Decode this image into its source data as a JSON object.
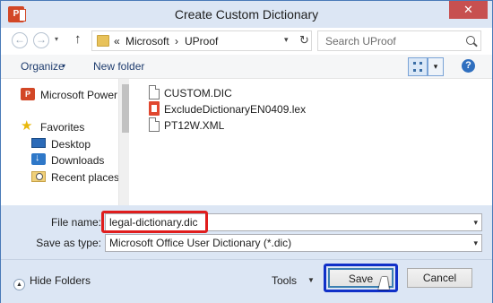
{
  "window": {
    "title": "Create Custom Dictionary",
    "app_icon_letter": "P",
    "close_label": "✕"
  },
  "address": {
    "back_icon": "←",
    "forward_icon": "→",
    "history_icon": "▾",
    "up_icon": "↑",
    "overflow": "«",
    "crumb_1": "Microsoft",
    "sep": "›",
    "crumb_2": "UProof",
    "dropdown_icon": "▾",
    "refresh_icon": "↻"
  },
  "search": {
    "placeholder": "Search UProof"
  },
  "toolbar": {
    "organize_label": "Organize",
    "organize_caret": "▾",
    "new_folder_label": "New folder",
    "view_dropdown": "▾",
    "help_label": "?"
  },
  "nav": {
    "items": [
      {
        "label": "Microsoft PowerPoint",
        "icon": "powerpoint-icon",
        "icon_text": "P"
      },
      {
        "label": "Favorites",
        "icon": "star-icon",
        "icon_text": "★"
      },
      {
        "label": "Desktop",
        "icon": "desktop-icon"
      },
      {
        "label": "Downloads",
        "icon": "downloads-icon"
      },
      {
        "label": "Recent places",
        "icon": "recent-places-icon"
      }
    ]
  },
  "files": [
    {
      "name": "CUSTOM.DIC",
      "icon": "document-icon"
    },
    {
      "name": "ExcludeDictionaryEN0409.lex",
      "icon": "office-document-icon"
    },
    {
      "name": "PT12W.XML",
      "icon": "document-icon"
    }
  ],
  "form": {
    "file_name_label": "File name:",
    "file_name_value": "legal-dictionary.dic",
    "save_as_type_label": "Save as type:",
    "save_as_type_value": "Microsoft Office User Dictionary (*.dic)",
    "caret": "▾"
  },
  "footer": {
    "hide_folders_chevron": "▲",
    "hide_folders_label": "Hide Folders",
    "tools_label": "Tools",
    "tools_caret": "▼",
    "save_label": "Save",
    "cancel_label": "Cancel"
  },
  "colors": {
    "window_chrome": "#dce6f4",
    "close_button": "#c75050",
    "file_name_highlight": "#e01d1d",
    "save_highlight": "#1030c8",
    "powerpoint": "#d24726"
  }
}
